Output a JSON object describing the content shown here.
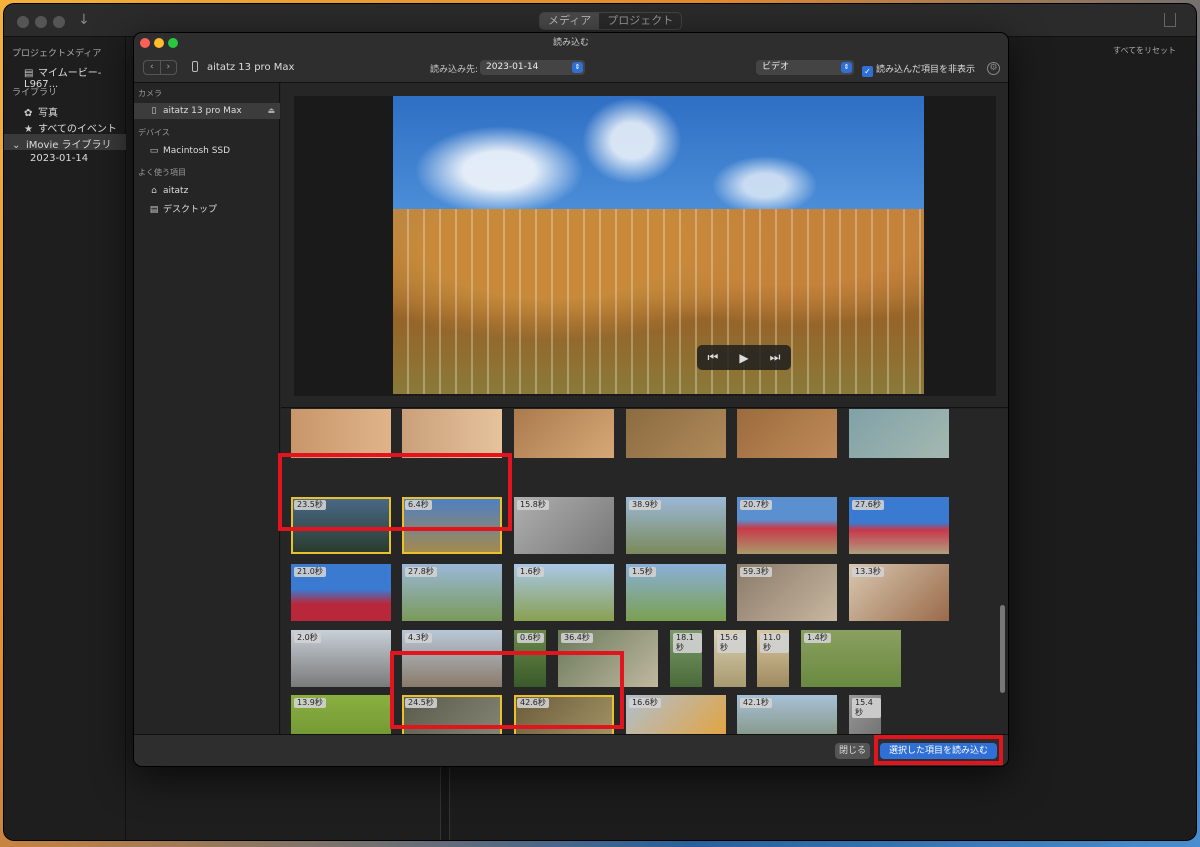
{
  "main": {
    "tabs": [
      {
        "label": "メディア"
      },
      {
        "label": "プロジェクト"
      }
    ],
    "sidebar": {
      "project_media_header": "プロジェクトメディア",
      "project_item": "マイムービー-L967...",
      "library_header": "ライブラリ",
      "items": [
        {
          "label": "写真"
        },
        {
          "label": "すべてのイベント"
        },
        {
          "label": "iMovie ライブラリ"
        },
        {
          "label": "2023-01-14"
        }
      ]
    },
    "reset_all": "すべてをリセット"
  },
  "dialog": {
    "title": "読み込む",
    "device_name": "aitatz 13 pro Max",
    "destination_label": "読み込み先:",
    "destination_value": "2023-01-14",
    "filter_value": "ビデオ",
    "hide_imported_label": "読み込んだ項目を非表示",
    "sidebar": {
      "camera_header": "カメラ",
      "camera_item": "aitatz 13 pro Max",
      "devices_header": "デバイス",
      "device_item": "Macintosh SSD",
      "favorites_header": "よく使う項目",
      "favorites": [
        {
          "label": "aitatz"
        },
        {
          "label": "デスクトップ"
        }
      ]
    },
    "close_label": "閉じる",
    "import_label": "選択した項目を読み込む"
  },
  "thumbnails": [
    {
      "dur": "23.5秒"
    },
    {
      "dur": "6.4秒"
    },
    {
      "dur": "15.8秒"
    },
    {
      "dur": "38.9秒"
    },
    {
      "dur": "20.7秒"
    },
    {
      "dur": "27.6秒"
    },
    {
      "dur": "21.0秒"
    },
    {
      "dur": "27.8秒"
    },
    {
      "dur": "1.6秒"
    },
    {
      "dur": "1.5秒"
    },
    {
      "dur": "59.3秒"
    },
    {
      "dur": "13.3秒"
    },
    {
      "dur": "2.0秒"
    },
    {
      "dur": "4.3秒"
    },
    {
      "dur": "0.6秒"
    },
    {
      "dur": "36.4秒"
    },
    {
      "dur": "18.1秒"
    },
    {
      "dur": "15.6秒"
    },
    {
      "dur": "11.0秒"
    },
    {
      "dur": "1.4秒"
    },
    {
      "dur": "13.9秒"
    },
    {
      "dur": "24.5秒"
    },
    {
      "dur": "42.6秒"
    },
    {
      "dur": "16.6秒"
    },
    {
      "dur": "42.1秒"
    },
    {
      "dur": "15.4秒"
    }
  ]
}
